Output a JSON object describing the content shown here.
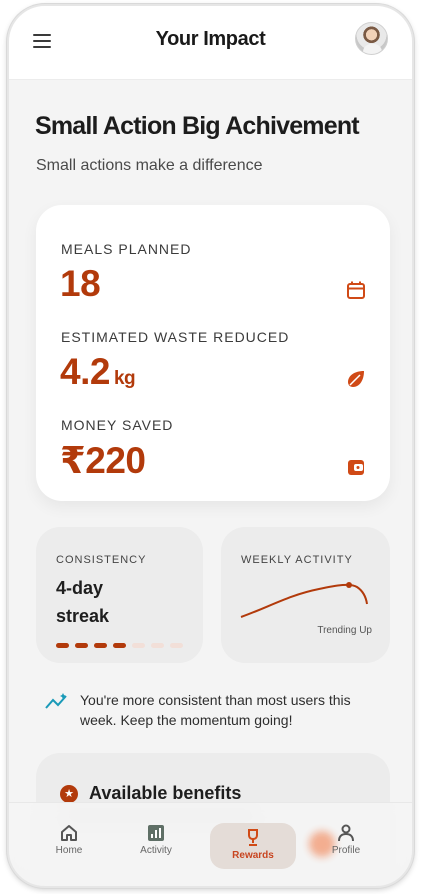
{
  "header": {
    "title": "Your Impact",
    "menu_icon": "hamburger-menu-icon",
    "avatar_icon": "user-avatar"
  },
  "hero": {
    "title": "Small Action Big Achivement",
    "subtitle": "Small actions make a difference"
  },
  "impact": {
    "meals_label": "MEALS PLANNED",
    "meals_value": "18",
    "meals_icon": "calendar-icon",
    "waste_label": "ESTIMATED WASTE REDUCED",
    "waste_value": "4.2",
    "waste_unit": "kg",
    "waste_icon": "leaf-icon",
    "money_label": "MONEY SAVED",
    "money_value": "₹220",
    "money_icon": "wallet-icon"
  },
  "consistency": {
    "label": "CONSISTENCY",
    "streak_line1": "4-day",
    "streak_line2": "streak",
    "days_completed": 4,
    "days_total": 7
  },
  "weekly_activity": {
    "label": "WEEKLY ACTIVITY",
    "trend_label": "Trending Up"
  },
  "insight": {
    "icon": "trending-sparkle-icon",
    "text": "You're more consistent than most users this week. Keep the momentum going!"
  },
  "benefits": {
    "icon": "star-badge-icon",
    "title": "Available benefits"
  },
  "bottom_nav": {
    "items": [
      {
        "label": "Home",
        "icon": "home-icon"
      },
      {
        "label": "Activity",
        "icon": "bar-chart-icon"
      },
      {
        "label": "Rewards",
        "icon": "trophy-icon"
      },
      {
        "label": "Profile",
        "icon": "profile-icon"
      }
    ],
    "active": "Rewards"
  },
  "colors": {
    "accent": "#b23a0b",
    "accent_light": "#f2a17e",
    "background": "#f4f4f4",
    "card": "#ffffff"
  }
}
